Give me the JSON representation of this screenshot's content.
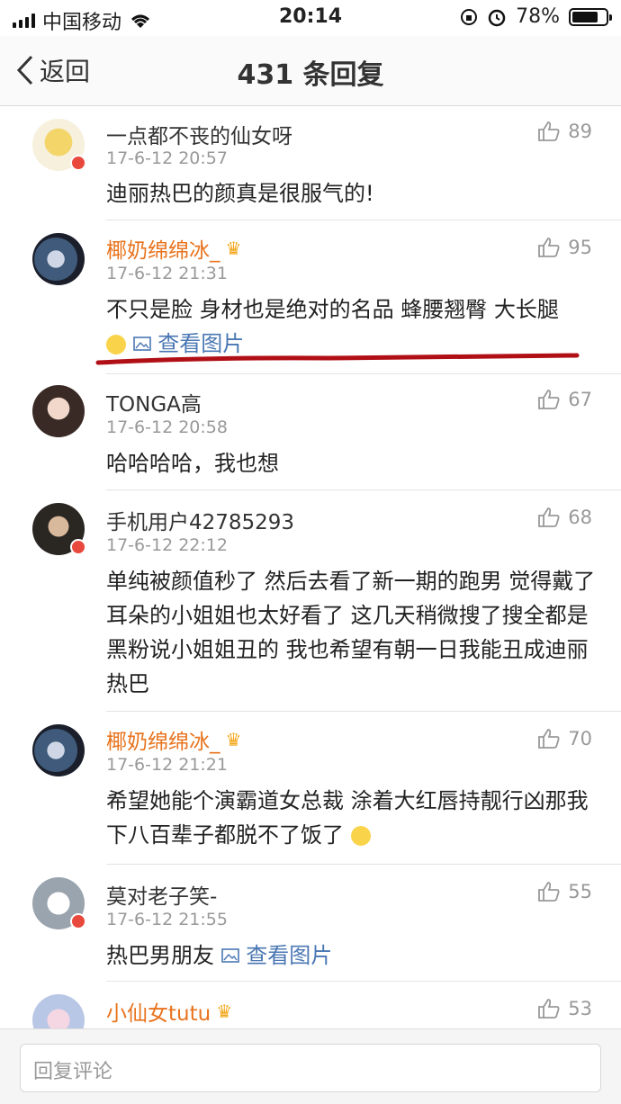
{
  "status_bar": {
    "carrier": "中国移动",
    "time": "20:14",
    "battery": "78%",
    "battery_level": 0.78
  },
  "nav": {
    "back_label": "返回",
    "title": "431 条回复"
  },
  "comments": [
    {
      "user": "一点都不丧的仙女呀",
      "time": "17-6-12 20:57",
      "likes": "89",
      "text": "迪丽热巴的颜真是很服气的!"
    },
    {
      "user": "椰奶绵绵冰_",
      "time": "17-6-12 21:31",
      "likes": "95",
      "text": "不只是脸 身材也是绝对的名品 蜂腰翘臀 大长腿",
      "link": "查看图片"
    },
    {
      "user": "TONGA高",
      "time": "17-6-12 20:58",
      "likes": "67",
      "text": "哈哈哈哈，我也想"
    },
    {
      "user": "手机用户42785293",
      "time": "17-6-12 22:12",
      "likes": "68",
      "text": "单纯被颜值秒了 然后去看了新一期的跑男 觉得戴了耳朵的小姐姐也太好看了 这几天稍微搜了搜全都是黑粉说小姐姐丑的 我也希望有朝一日我能丑成迪丽热巴"
    },
    {
      "user": "椰奶绵绵冰_",
      "time": "17-6-12 21:21",
      "likes": "70",
      "text": "希望她能个演霸道女总裁 涂着大红唇持靓行凶那我下八百辈子都脱不了饭了"
    },
    {
      "user": "莫对老子笑-",
      "time": "17-6-12 21:55",
      "likes": "55",
      "text": "热巴男朋友",
      "link": "查看图片"
    },
    {
      "user": "小仙女tutu",
      "likes": "53"
    }
  ],
  "reply": {
    "placeholder": "回复评论"
  },
  "colors": {
    "vip_name": "#e8731d",
    "link": "#4a77b3",
    "like": "#999999",
    "underline": "#b10f16"
  }
}
